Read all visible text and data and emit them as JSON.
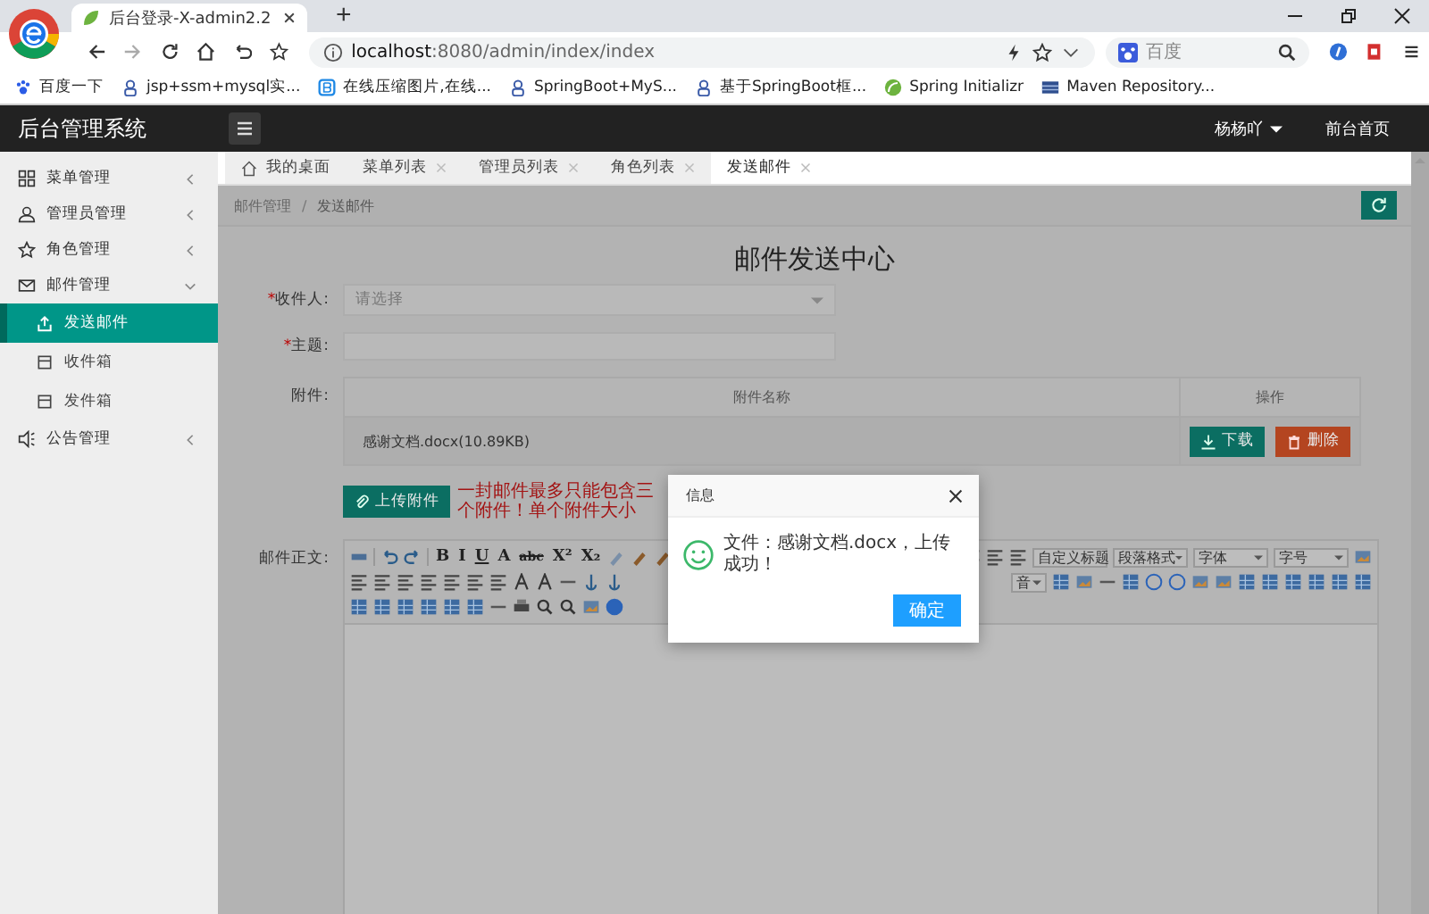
{
  "browser": {
    "tab_title": "后台登录-X-admin2.2",
    "new_tab": "+",
    "url_host": "localhost",
    "url_path": ":8080/admin/index/index",
    "search_placeholder": "百度",
    "bookmarks": [
      {
        "label": "百度一下",
        "kind": "paw"
      },
      {
        "label": "jsp+ssm+mysql实...",
        "kind": "user"
      },
      {
        "label": "在线压缩图片,在线...",
        "kind": "letter"
      },
      {
        "label": "SpringBoot+MyS...",
        "kind": "user"
      },
      {
        "label": "基于SpringBoot框...",
        "kind": "user"
      },
      {
        "label": "Spring Initializr",
        "kind": "leaf"
      },
      {
        "label": "Maven Repository...",
        "kind": "grid"
      }
    ]
  },
  "header": {
    "title": "后台管理系统",
    "user": "杨杨吖",
    "home_link": "前台首页"
  },
  "sidebar": {
    "items": [
      {
        "label": "菜单管理",
        "kind": "grid",
        "expanded": false
      },
      {
        "label": "管理员管理",
        "kind": "user",
        "expanded": false
      },
      {
        "label": "角色管理",
        "kind": "star",
        "expanded": false
      },
      {
        "label": "邮件管理",
        "kind": "mail",
        "expanded": true,
        "children": [
          {
            "label": "发送邮件",
            "kind": "upload",
            "selected": true
          },
          {
            "label": "收件箱",
            "kind": "inbox",
            "selected": false
          },
          {
            "label": "发件箱",
            "kind": "outbox",
            "selected": false
          }
        ]
      },
      {
        "label": "公告管理",
        "kind": "speaker",
        "expanded": false
      }
    ]
  },
  "tabs": [
    {
      "label": "我的桌面",
      "closable": false,
      "selected": false
    },
    {
      "label": "菜单列表",
      "closable": true,
      "selected": false
    },
    {
      "label": "管理员列表",
      "closable": true,
      "selected": false
    },
    {
      "label": "角色列表",
      "closable": true,
      "selected": false
    },
    {
      "label": "发送邮件",
      "closable": true,
      "selected": true
    }
  ],
  "breadcrumb": {
    "items": [
      "邮件管理",
      "发送邮件"
    ],
    "separator": "/"
  },
  "form": {
    "title": "邮件发送中心",
    "required_mark": "*",
    "recipient": {
      "label": "收件人:",
      "placeholder": "请选择"
    },
    "subject": {
      "label": "主题:"
    },
    "attachments": {
      "label": "附件:",
      "columns": [
        "附件名称",
        "操作"
      ],
      "rows": [
        {
          "name": "感谢文档.docx(10.89KB)",
          "download": "下载",
          "delete": "删除"
        }
      ]
    },
    "upload_button": "上传附件",
    "note": "一封邮件最多只能包含三个附件！单个附件大小",
    "body_label": "邮件正文:",
    "editor": {
      "format_buttons": [
        "B",
        "I",
        "U",
        "A",
        "abc",
        "X²",
        "X₂"
      ],
      "selects": [
        "自定义标题",
        "段落格式",
        "字体",
        "字号"
      ],
      "row2_select": "音"
    }
  },
  "dialog": {
    "title": "信息",
    "message": "文件：感谢文档.docx，上传成功！",
    "confirm": "确定"
  }
}
